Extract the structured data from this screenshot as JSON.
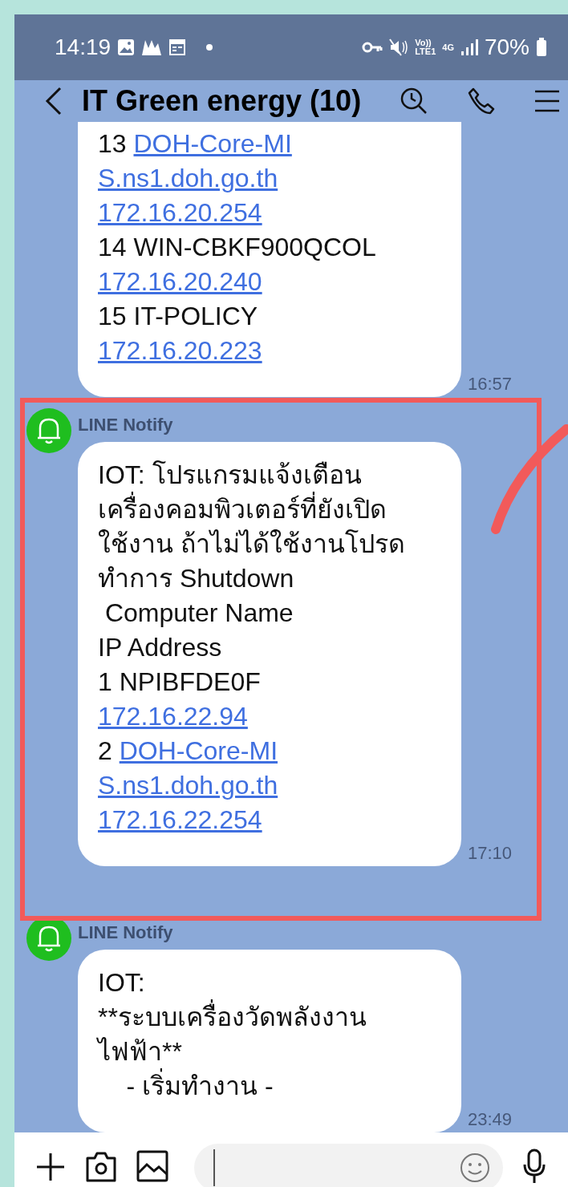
{
  "status_bar": {
    "time": "14:19",
    "volte_top": "Vo))",
    "volte_bottom": "LTE1",
    "network": "4G",
    "battery": "70%"
  },
  "header": {
    "title": "IT Green energy (10)"
  },
  "messages": [
    {
      "cut_top": true,
      "time": "16:57",
      "lines": [
        [
          {
            "kind": "text",
            "text": "13 "
          },
          {
            "kind": "link",
            "text": "DOH-Core-MI"
          }
        ],
        [
          {
            "kind": "link",
            "text": "S.ns1.doh.go.th"
          }
        ],
        [
          {
            "kind": "link",
            "text": "172.16.20.254"
          }
        ],
        [
          {
            "kind": "text",
            "text": "14 WIN-CBKF900QCOL"
          }
        ],
        [
          {
            "kind": "link",
            "text": "172.16.20.240"
          }
        ],
        [
          {
            "kind": "text",
            "text": "15 IT-POLICY"
          }
        ],
        [
          {
            "kind": "link",
            "text": "172.16.20.223"
          }
        ]
      ]
    },
    {
      "sender": "LINE Notify",
      "cut_top": false,
      "time": "17:10",
      "lines": [
        [
          {
            "kind": "text",
            "text": "IOT: โปรแกรมแจ้งเตือน"
          }
        ],
        [
          {
            "kind": "text",
            "text": "เครื่องคอมพิวเตอร์ที่ยังเปิด"
          }
        ],
        [
          {
            "kind": "text",
            "text": "ใช้งาน ถ้าไม่ได้ใช้งานโปรด"
          }
        ],
        [
          {
            "kind": "text",
            "text": "ทำการ Shutdown"
          }
        ],
        [
          {
            "kind": "text",
            "text": " Computer Name"
          }
        ],
        [
          {
            "kind": "text",
            "text": "IP Address"
          }
        ],
        [
          {
            "kind": "text",
            "text": "1 NPIBFDE0F"
          }
        ],
        [
          {
            "kind": "link",
            "text": "172.16.22.94"
          }
        ],
        [
          {
            "kind": "text",
            "text": "2 "
          },
          {
            "kind": "link",
            "text": "DOH-Core-MI"
          }
        ],
        [
          {
            "kind": "link",
            "text": "S.ns1.doh.go.th"
          }
        ],
        [
          {
            "kind": "link",
            "text": "172.16.22.254"
          }
        ]
      ]
    },
    {
      "sender": "LINE Notify",
      "cut_top": false,
      "time": "23:49",
      "lines": [
        [
          {
            "kind": "text",
            "text": "IOT:"
          }
        ],
        [
          {
            "kind": "text",
            "text": "**ระบบเครื่องวัดพลังงาน"
          }
        ],
        [
          {
            "kind": "text",
            "text": "ไฟฟ้า**"
          }
        ],
        [
          {
            "kind": "text",
            "text": "    - เริ่มทำงาน -"
          }
        ]
      ]
    }
  ]
}
